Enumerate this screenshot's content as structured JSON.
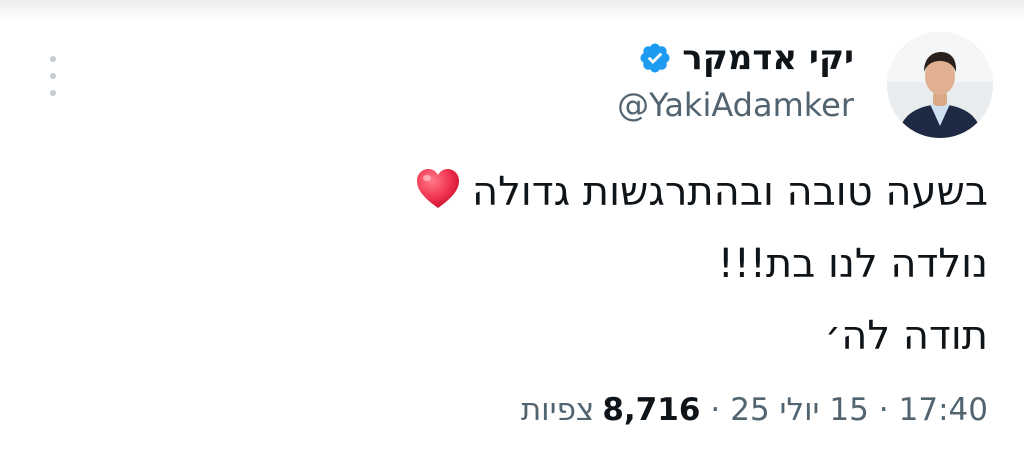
{
  "tweet": {
    "author": {
      "display_name": "יקי אדמקר",
      "handle": "@YakiAdamker",
      "verified": true,
      "avatar_icon": "user-photo"
    },
    "text_lines": [
      "בשעה טובה ובהתרגשות גדולה",
      "נולדה לנו בת!!!",
      "תודה לה׳"
    ],
    "emoji": "red-heart",
    "meta": {
      "time": "17:40",
      "separator": "·",
      "date": "15 יולי 25",
      "views_count": "8,716",
      "views_label": "צפיות"
    },
    "more_icon": "more-vertical-icon"
  },
  "colors": {
    "verified_badge": "#1d9bf0",
    "text_primary": "#0f1419",
    "text_secondary": "#536471",
    "heart": "#f0334f"
  }
}
